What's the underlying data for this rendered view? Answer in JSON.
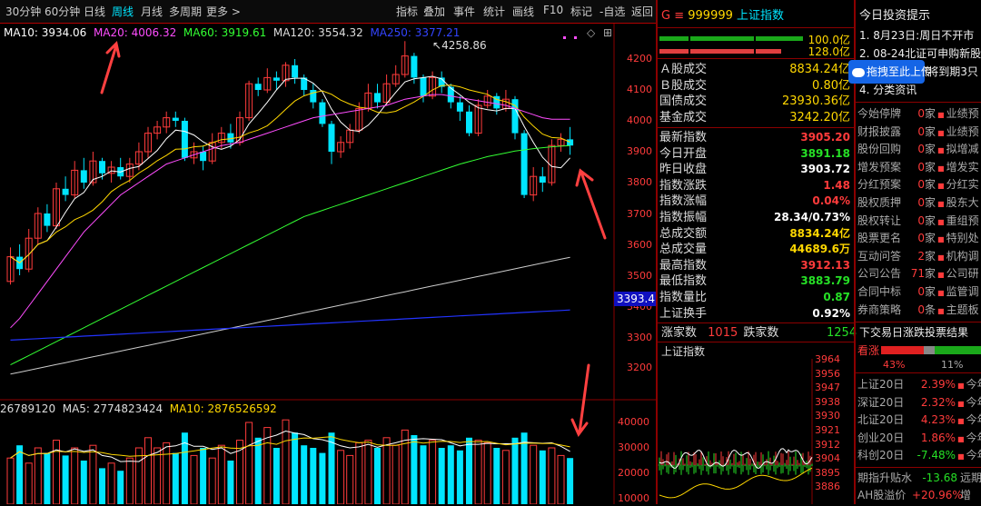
{
  "toolbar": {
    "items": [
      "30分钟",
      "60分钟",
      "日线",
      "周线",
      "月线",
      "多周期",
      "更多 >"
    ],
    "right_items": [
      "指标",
      "叠加",
      "事件",
      "统计",
      "画线",
      "F10",
      "标记",
      "-自选",
      "返回"
    ],
    "active": "周线"
  },
  "ma_legend": [
    {
      "label": "MA10: 3934.06",
      "color": "#ffffff"
    },
    {
      "label": "MA20: 4006.32",
      "color": "#ff4dff"
    },
    {
      "label": "MA60: 3919.61",
      "color": "#33ff33"
    },
    {
      "label": "MA120: 3554.32",
      "color": "#dddddd"
    },
    {
      "label": "MA250: 3377.21",
      "color": "#3344ff"
    }
  ],
  "price_axis": [
    "4200",
    "4100",
    "4000",
    "3900",
    "3800",
    "3700",
    "3600",
    "3500",
    "3400",
    "3300",
    "3200"
  ],
  "current_price_tag": "3393.4",
  "peak_label": "4258.86",
  "volume_legend": [
    {
      "label": "26789120",
      "color": "#dddddd"
    },
    {
      "label": "MA5: 2774823424",
      "color": "#dddddd"
    },
    {
      "label": "MA10: 2876526592",
      "color": "#ffd700"
    }
  ],
  "volume_axis": [
    "40000",
    "30000",
    "20000",
    "10000"
  ],
  "quote": {
    "code_prefix": "G ≡",
    "code": "999999",
    "name": "上证指数",
    "bar_labels": [
      "100.0亿",
      "128.0亿"
    ],
    "stock_rows": [
      {
        "label": "Ａ股成交",
        "value": "8834.24亿",
        "color": "#ffd700"
      },
      {
        "label": "Ｂ股成交",
        "value": "0.80亿",
        "color": "#ffd700"
      },
      {
        "label": "国债成交",
        "value": "23930.36亿",
        "color": "#ffd700"
      },
      {
        "label": "基金成交",
        "value": "3242.20亿",
        "color": "#ffd700"
      }
    ],
    "index_rows": [
      {
        "label": "最新指数",
        "value": "3905.20",
        "color": "#ff3b3b"
      },
      {
        "label": "今日开盘",
        "value": "3891.18",
        "color": "#26e026"
      },
      {
        "label": "昨日收盘",
        "value": "3903.72",
        "color": "#ffffff"
      },
      {
        "label": "指数涨跌",
        "value": "1.48",
        "color": "#ff3b3b"
      },
      {
        "label": "指数涨幅",
        "value": "0.04%",
        "color": "#ff3b3b"
      },
      {
        "label": "指数振幅",
        "value": "28.34/0.73%",
        "color": "#ffffff"
      },
      {
        "label": "总成交额",
        "value": "8834.24亿",
        "color": "#ffd700"
      },
      {
        "label": "总成交量",
        "value": "44689.6万",
        "color": "#ffd700"
      },
      {
        "label": "最高指数",
        "value": "3912.13",
        "color": "#ff3b3b"
      },
      {
        "label": "最低指数",
        "value": "3883.79",
        "color": "#26e026"
      },
      {
        "label": "指数量比",
        "value": "0.87",
        "color": "#26e026"
      },
      {
        "label": "上证换手",
        "value": "0.92%",
        "color": "#ffffff"
      }
    ],
    "up_label": "涨家数",
    "up_value": "1015",
    "down_label": "跌家数",
    "down_value": "1254",
    "mini_title": "上证指数",
    "mini_axis": [
      "3964",
      "3956",
      "3947",
      "3938",
      "3930",
      "3921",
      "3912",
      "3904",
      "3895",
      "3886"
    ]
  },
  "upload_button": "拖拽至此上传",
  "news": {
    "title": "今日投资提示",
    "items": [
      "1. 8月23日:周日不开市",
      "2. 08-24北证可申购新股",
      "3. 今日可转债将到期3只",
      "4. 分类资讯"
    ]
  },
  "notices": [
    {
      "label": "今始停牌",
      "count": "0",
      "unit": "家",
      "tag": "业绩预"
    },
    {
      "label": "财报披露",
      "count": "0",
      "unit": "家",
      "tag": "业绩预"
    },
    {
      "label": "股份回购",
      "count": "0",
      "unit": "家",
      "tag": "拟增减"
    },
    {
      "label": "增发预案",
      "count": "0",
      "unit": "家",
      "tag": "增发实"
    },
    {
      "label": "分红预案",
      "count": "0",
      "unit": "家",
      "tag": "分红实"
    },
    {
      "label": "股权质押",
      "count": "0",
      "unit": "家",
      "tag": "股东大"
    },
    {
      "label": "股权转让",
      "count": "0",
      "unit": "家",
      "tag": "重组预"
    },
    {
      "label": "股票更名",
      "count": "0",
      "unit": "家",
      "tag": "特别处"
    },
    {
      "label": "互动问答",
      "count": "2",
      "unit": "家",
      "tag": "机构调"
    },
    {
      "label": "公司公告",
      "count": "71",
      "unit": "家",
      "tag": "公司研"
    },
    {
      "label": "合同中标",
      "count": "0",
      "unit": "家",
      "tag": "监管调"
    },
    {
      "label": "券商策略",
      "count": "0",
      "unit": "条",
      "tag": "主题板"
    }
  ],
  "vote": {
    "title": "下交易日涨跌投票结果",
    "bull_label": "看涨",
    "bull_pct": "43%",
    "neutral_pct": "11%",
    "bull_fraction": 0.43,
    "neutral_fraction": 0.11
  },
  "period_rows": [
    {
      "label": "上证20日",
      "value": "2.39%",
      "color": "#ff3b3b",
      "tail": "今年"
    },
    {
      "label": "深证20日",
      "value": "2.32%",
      "color": "#ff3b3b",
      "tail": "今年"
    },
    {
      "label": "北证20日",
      "value": "4.23%",
      "color": "#ff3b3b",
      "tail": "今年"
    },
    {
      "label": "创业20日",
      "value": "1.86%",
      "color": "#ff3b3b",
      "tail": "今年"
    },
    {
      "label": "科创20日",
      "value": "-7.48%",
      "color": "#26e026",
      "tail": "今年"
    }
  ],
  "bottom_rows": [
    {
      "label": "期指升贴水",
      "value": "-13.68",
      "color": "#26e026",
      "tail": "远期"
    },
    {
      "label": "AH股溢价",
      "value": "+20.96%",
      "color": "#ff3b3b",
      "tail": "增"
    }
  ]
}
